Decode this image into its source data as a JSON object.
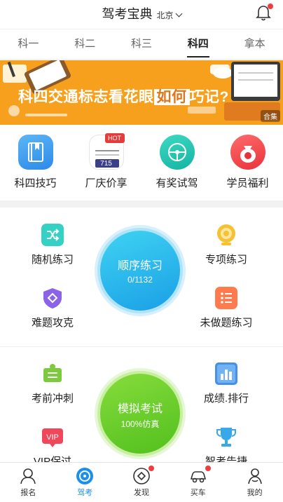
{
  "header": {
    "title": "驾考宝典",
    "city": "北京",
    "icons": {
      "city_dropdown": "chevron-down-icon",
      "notification": "bell-icon"
    },
    "notification_dot_color": "#f03c3c"
  },
  "tabs": [
    {
      "label": "科一",
      "active": false
    },
    {
      "label": "科二",
      "active": false
    },
    {
      "label": "科三",
      "active": false
    },
    {
      "label": "科四",
      "active": true
    },
    {
      "label": "拿本",
      "active": false
    }
  ],
  "banner": {
    "text_before": "科四交通标志看花眼",
    "text_highlight": "如何",
    "text_after": "巧记?",
    "tag": "合集",
    "background_color": "#f7a01e"
  },
  "quick_actions": [
    {
      "label": "科四技巧",
      "icon": "book-icon",
      "color": "#3a9ef0"
    },
    {
      "label": "厂庆价享",
      "icon": "promo-image-icon",
      "badge": "HOT",
      "badge_number": "715",
      "color": "#e43b3b"
    },
    {
      "label": "有奖试驾",
      "icon": "steering-wheel-icon",
      "color": "#22c2b0"
    },
    {
      "label": "学员福利",
      "icon": "money-bag-icon",
      "color": "#f0454b"
    }
  ],
  "practice": {
    "items_top": [
      {
        "label": "随机练习",
        "icon": "shuffle-icon"
      },
      {
        "label": "专项练习",
        "icon": "target-icon"
      },
      {
        "label": "难题攻克",
        "icon": "shield-icon"
      },
      {
        "label": "未做题练习",
        "icon": "list-icon"
      }
    ],
    "main_blue": {
      "title": "顺序练习",
      "progress": "0/1132"
    },
    "items_bottom": [
      {
        "label": "考前冲刺",
        "icon": "sprint-book-icon"
      },
      {
        "label": "成绩.排行",
        "icon": "bar-chart-icon"
      },
      {
        "label": "VIP保过",
        "icon": "vip-icon"
      },
      {
        "label": "智考告捷",
        "icon": "trophy-icon"
      }
    ],
    "main_green": {
      "title": "模拟考试",
      "subtitle": "100%仿真"
    }
  },
  "bottom_nav": [
    {
      "label": "报名",
      "icon": "signup-icon",
      "active": false,
      "dot": false
    },
    {
      "label": "驾考",
      "icon": "drive-icon",
      "active": true,
      "dot": false
    },
    {
      "label": "发现",
      "icon": "discover-icon",
      "active": false,
      "dot": true
    },
    {
      "label": "买车",
      "icon": "car-icon",
      "active": false,
      "dot": true
    },
    {
      "label": "我的",
      "icon": "profile-icon",
      "active": false,
      "dot": false
    }
  ]
}
